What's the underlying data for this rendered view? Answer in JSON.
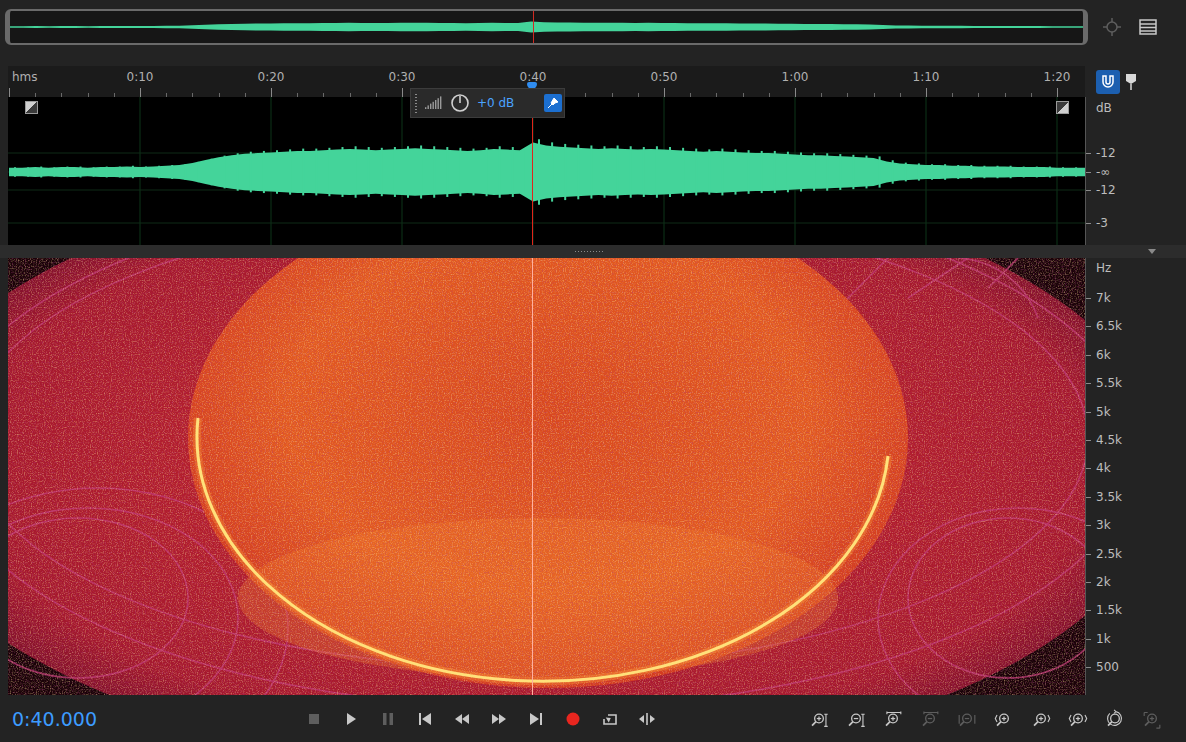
{
  "overview": {
    "zoom_navigator": {
      "disabled": true
    }
  },
  "ruler": {
    "unit": "hms",
    "labels": [
      "0:10",
      "0:20",
      "0:30",
      "0:40",
      "0:50",
      "1:00",
      "1:10",
      "1:20"
    ],
    "snap": {
      "on": true
    }
  },
  "playhead": {
    "level": 0.487
  },
  "hud": {
    "gain": "+0 dB",
    "pinned": true
  },
  "waveform": {
    "scale_title": "dB",
    "scale": [
      "-12",
      "-∞",
      "-12",
      "-3"
    ],
    "envelope": [
      0.06,
      0.06,
      0.07,
      0.06,
      0.07,
      0.07,
      0.06,
      0.07,
      0.07,
      0.08,
      0.07,
      0.08,
      0.09,
      0.1,
      0.13,
      0.17,
      0.21,
      0.24,
      0.26,
      0.27,
      0.28,
      0.29,
      0.3,
      0.3,
      0.31,
      0.32,
      0.33,
      0.32,
      0.31,
      0.32,
      0.33,
      0.34,
      0.33,
      0.32,
      0.31,
      0.3,
      0.31,
      0.33,
      0.32,
      0.31,
      0.42,
      0.38,
      0.36,
      0.35,
      0.34,
      0.33,
      0.34,
      0.33,
      0.32,
      0.33,
      0.32,
      0.31,
      0.3,
      0.29,
      0.3,
      0.29,
      0.28,
      0.27,
      0.27,
      0.26,
      0.25,
      0.24,
      0.24,
      0.23,
      0.22,
      0.21,
      0.2,
      0.15,
      0.12,
      0.11,
      0.1,
      0.1,
      0.09,
      0.09,
      0.08,
      0.08,
      0.08,
      0.07,
      0.07,
      0.07,
      0.06,
      0.06,
      0.06,
      0.06
    ]
  },
  "spectrogram": {
    "scale_title": "Hz",
    "scale": [
      "7k",
      "6.5k",
      "6k",
      "5.5k",
      "5k",
      "4.5k",
      "4k",
      "3.5k",
      "3k",
      "2.5k",
      "2k",
      "1.5k",
      "1k",
      "500"
    ]
  },
  "status": {
    "time": "0:40.000"
  },
  "transport": [
    {
      "kind": "stop",
      "disabled": true
    },
    {
      "kind": "play",
      "disabled": false
    },
    {
      "kind": "pause",
      "disabled": true
    },
    {
      "kind": "go-to-start",
      "disabled": false
    },
    {
      "kind": "rewind",
      "disabled": false
    },
    {
      "kind": "fast-forward",
      "disabled": false
    },
    {
      "kind": "go-to-end",
      "disabled": false
    },
    {
      "kind": "record",
      "disabled": false
    },
    {
      "kind": "loop",
      "disabled": false
    },
    {
      "kind": "skip-selection",
      "disabled": false
    }
  ],
  "zoom_controls": [
    {
      "kind": "zoom-in-amplitude",
      "disabled": false
    },
    {
      "kind": "zoom-out-amplitude",
      "disabled": false
    },
    {
      "kind": "zoom-in-time",
      "disabled": false
    },
    {
      "kind": "zoom-out-time",
      "disabled": true
    },
    {
      "kind": "zoom-out-full",
      "disabled": true
    },
    {
      "kind": "zoom-in-start",
      "disabled": false
    },
    {
      "kind": "zoom-in-end",
      "disabled": false
    },
    {
      "kind": "zoom-selection",
      "disabled": false
    },
    {
      "kind": "zoom-reset",
      "disabled": false
    },
    {
      "kind": "zoom-fit",
      "disabled": true
    }
  ]
}
